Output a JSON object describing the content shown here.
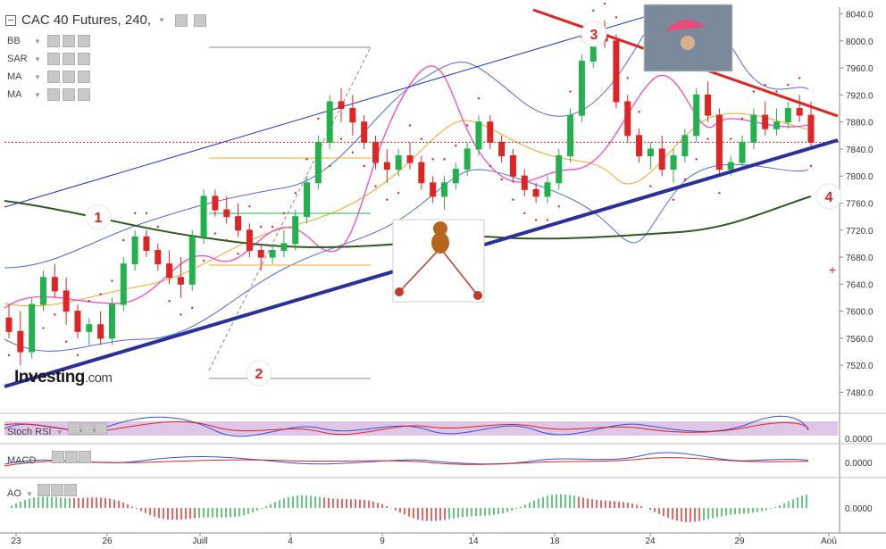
{
  "header": {
    "title": "CAC 40 Futures, 240,",
    "indicators": [
      "BB",
      "SAR",
      "MA",
      "MA"
    ]
  },
  "logo": {
    "brand": "Investing",
    "suffix": ".com"
  },
  "price_axis": {
    "ticks": [
      "8040.0",
      "8000.0",
      "7960.0",
      "7920.0",
      "7880.0",
      "7840.0",
      "7800.0",
      "7760.0",
      "7720.0",
      "7680.0",
      "7640.0",
      "7600.0",
      "7560.0",
      "7520.0",
      "7480.0"
    ]
  },
  "time_axis": {
    "labels": [
      "23",
      "26",
      "Juill",
      "4",
      "9",
      "14",
      "18",
      "24",
      "29",
      "Aoû"
    ]
  },
  "annotations": [
    "1",
    "2",
    "3",
    "4"
  ],
  "panes": {
    "stoch_rsi": {
      "label": "Stoch RSI",
      "value": "0.0000"
    },
    "macd": {
      "label": "MACD",
      "value": "0.0000"
    },
    "ao": {
      "label": "AO",
      "value": "0.0000"
    }
  },
  "colors": {
    "bull": "#22b14c",
    "bear": "#e02424",
    "bb": "#5566dd",
    "sar": "#e02424",
    "ma_fast": "#ee55cc",
    "ma_mid": "#f5a623",
    "ma_slow": "#2d5a1d",
    "trendline": "#2a2f9a",
    "resistance": "#e02424",
    "channel": "#2233cc",
    "price_line": "#cc2222"
  },
  "chart_data": {
    "type": "candlestick",
    "title": "CAC 40 Futures, 240,",
    "ylim": [
      7470,
      8050
    ],
    "candles": [
      [
        7590,
        7610,
        7560,
        7570
      ],
      [
        7570,
        7600,
        7520,
        7540
      ],
      [
        7540,
        7620,
        7530,
        7610
      ],
      [
        7610,
        7660,
        7600,
        7650
      ],
      [
        7650,
        7670,
        7620,
        7630
      ],
      [
        7630,
        7650,
        7580,
        7600
      ],
      [
        7600,
        7610,
        7560,
        7570
      ],
      [
        7570,
        7590,
        7550,
        7580
      ],
      [
        7580,
        7600,
        7550,
        7560
      ],
      [
        7560,
        7620,
        7550,
        7610
      ],
      [
        7610,
        7680,
        7600,
        7670
      ],
      [
        7670,
        7720,
        7660,
        7710
      ],
      [
        7710,
        7720,
        7680,
        7690
      ],
      [
        7690,
        7700,
        7660,
        7670
      ],
      [
        7670,
        7690,
        7640,
        7650
      ],
      [
        7650,
        7680,
        7620,
        7640
      ],
      [
        7640,
        7720,
        7630,
        7710
      ],
      [
        7710,
        7780,
        7700,
        7770
      ],
      [
        7770,
        7780,
        7740,
        7750
      ],
      [
        7750,
        7770,
        7730,
        7740
      ],
      [
        7740,
        7760,
        7710,
        7720
      ],
      [
        7720,
        7730,
        7680,
        7690
      ],
      [
        7690,
        7700,
        7660,
        7680
      ],
      [
        7680,
        7700,
        7670,
        7690
      ],
      [
        7690,
        7720,
        7680,
        7700
      ],
      [
        7700,
        7750,
        7690,
        7740
      ],
      [
        7740,
        7800,
        7730,
        7790
      ],
      [
        7790,
        7860,
        7780,
        7850
      ],
      [
        7850,
        7920,
        7840,
        7910
      ],
      [
        7910,
        7930,
        7880,
        7900
      ],
      [
        7900,
        7920,
        7860,
        7880
      ],
      [
        7880,
        7890,
        7840,
        7850
      ],
      [
        7850,
        7860,
        7810,
        7820
      ],
      [
        7820,
        7840,
        7790,
        7810
      ],
      [
        7810,
        7840,
        7800,
        7830
      ],
      [
        7830,
        7850,
        7810,
        7820
      ],
      [
        7820,
        7830,
        7780,
        7790
      ],
      [
        7790,
        7800,
        7760,
        7770
      ],
      [
        7770,
        7800,
        7750,
        7790
      ],
      [
        7790,
        7820,
        7780,
        7810
      ],
      [
        7810,
        7850,
        7800,
        7840
      ],
      [
        7840,
        7890,
        7830,
        7880
      ],
      [
        7880,
        7890,
        7840,
        7850
      ],
      [
        7850,
        7860,
        7820,
        7830
      ],
      [
        7830,
        7840,
        7790,
        7800
      ],
      [
        7800,
        7810,
        7770,
        7780
      ],
      [
        7780,
        7790,
        7760,
        7770
      ],
      [
        7770,
        7800,
        7760,
        7790
      ],
      [
        7790,
        7840,
        7780,
        7830
      ],
      [
        7830,
        7900,
        7820,
        7890
      ],
      [
        7890,
        7980,
        7880,
        7970
      ],
      [
        7970,
        8020,
        7960,
        8010
      ],
      [
        8010,
        8030,
        7990,
        8000
      ],
      [
        8000,
        8010,
        7900,
        7910
      ],
      [
        7910,
        7920,
        7850,
        7860
      ],
      [
        7860,
        7870,
        7820,
        7830
      ],
      [
        7830,
        7850,
        7810,
        7840
      ],
      [
        7840,
        7860,
        7800,
        7810
      ],
      [
        7810,
        7840,
        7790,
        7830
      ],
      [
        7830,
        7870,
        7820,
        7860
      ],
      [
        7860,
        7930,
        7850,
        7920
      ],
      [
        7920,
        7940,
        7880,
        7890
      ],
      [
        7890,
        7900,
        7800,
        7810
      ],
      [
        7810,
        7830,
        7800,
        7820
      ],
      [
        7820,
        7860,
        7810,
        7850
      ],
      [
        7850,
        7900,
        7840,
        7890
      ],
      [
        7890,
        7910,
        7860,
        7870
      ],
      [
        7870,
        7900,
        7860,
        7880
      ],
      [
        7880,
        7910,
        7870,
        7900
      ],
      [
        7900,
        7920,
        7880,
        7890
      ],
      [
        7890,
        7910,
        7840,
        7850
      ]
    ],
    "price_line": 7850,
    "x_labels": [
      "23",
      "26",
      "Juill",
      "4",
      "9",
      "14",
      "18",
      "24",
      "29",
      "Aoû"
    ]
  }
}
